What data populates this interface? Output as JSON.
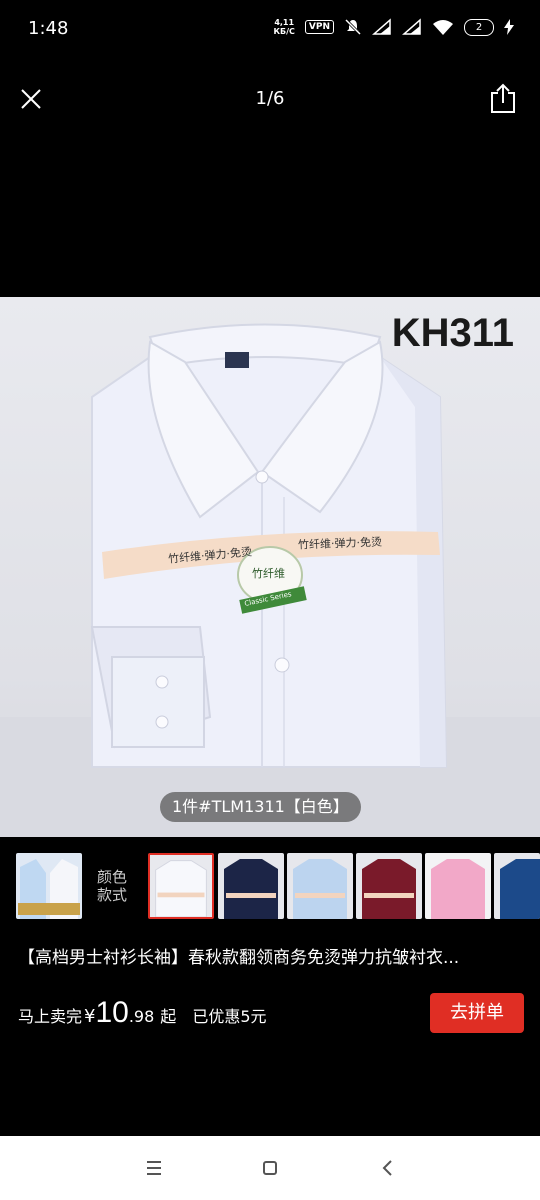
{
  "status_bar": {
    "time": "1:48",
    "net_speed_value": "4,11",
    "net_speed_unit": "КБ/С",
    "vpn": "VPN",
    "battery": "2",
    "icons": [
      "mute-icon",
      "signal-icon",
      "signal-icon",
      "wifi-icon",
      "battery-icon",
      "charging-icon"
    ]
  },
  "top_nav": {
    "counter": "1/6",
    "close_icon": "close-icon",
    "share_icon": "share-icon"
  },
  "product_image": {
    "model_code": "KH311",
    "band_text": "竹纤维·弹力·免烫",
    "band_text_short": "竹纤维·弹力·免烫",
    "badge_text": "竹纤维",
    "badge_ribbon": "Classic Series",
    "caption": "1件#TLM1311【白色】",
    "shirt_color": "#eef0fa"
  },
  "thumbnails": {
    "color_label_line1": "颜色",
    "color_label_line2": "款式",
    "items": [
      {
        "name": "thumb-shirt-lightblue-white",
        "color": "#bfd8f2"
      },
      {
        "name": "thumb-shirt-white",
        "color": "#f1f2f6"
      },
      {
        "name": "thumb-shirt-navy",
        "color": "#1c2547"
      },
      {
        "name": "thumb-shirt-lightblue",
        "color": "#bcd4ef"
      },
      {
        "name": "thumb-shirt-wine",
        "color": "#7a1a2a"
      },
      {
        "name": "thumb-shirt-pink",
        "color": "#f2a8c8"
      },
      {
        "name": "thumb-shirt-blue",
        "color": "#1c4a8a"
      }
    ]
  },
  "product": {
    "title": "【高档男士衬衫长袖】春秋款翻领商务免烫弹力抗皱衬衣..."
  },
  "price": {
    "promo": "马上卖完",
    "currency": "¥",
    "integer": "10",
    "decimal": ".98",
    "suffix": "起",
    "discount": "已优惠5元",
    "button": "去拼单"
  },
  "colors": {
    "accent": "#e02e24",
    "background": "#000000"
  },
  "nav_bar": {
    "icons": [
      "menu-icon",
      "home-square-icon",
      "back-icon"
    ]
  }
}
